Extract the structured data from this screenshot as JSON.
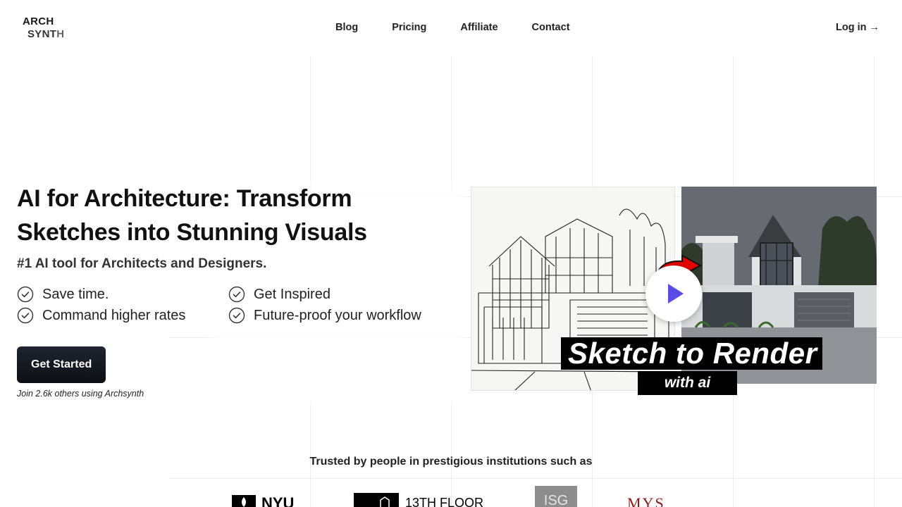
{
  "header": {
    "logo_line1": "ARCH",
    "logo_line2_a": "SYNT",
    "logo_line2_b": "H",
    "nav": [
      "Blog",
      "Pricing",
      "Affiliate",
      "Contact"
    ],
    "login": "Log in →"
  },
  "hero": {
    "title": "AI for Architecture: Transform Sketches into Stunning Visuals",
    "subtitle": "#1 AI tool for Architects and Designers.",
    "features": [
      "Save time.",
      "Get Inspired",
      "Command higher rates",
      "Future-proof your workflow"
    ],
    "cta": "Get Started",
    "join": "Join 2.6k others using Archsynth"
  },
  "video": {
    "caption_main": "Sketch to Render",
    "caption_sub": "with ai"
  },
  "trusted": {
    "heading": "Trusted by people in prestigious institutions such as",
    "logos": [
      "NYU",
      "13TH FLOOR",
      "ISG",
      "MYS"
    ]
  },
  "colors": {
    "cta_bg": "#111418",
    "play_accent": "#5b4ce6",
    "arrow_red": "#e30000",
    "mys_red": "#8b1a1a"
  }
}
